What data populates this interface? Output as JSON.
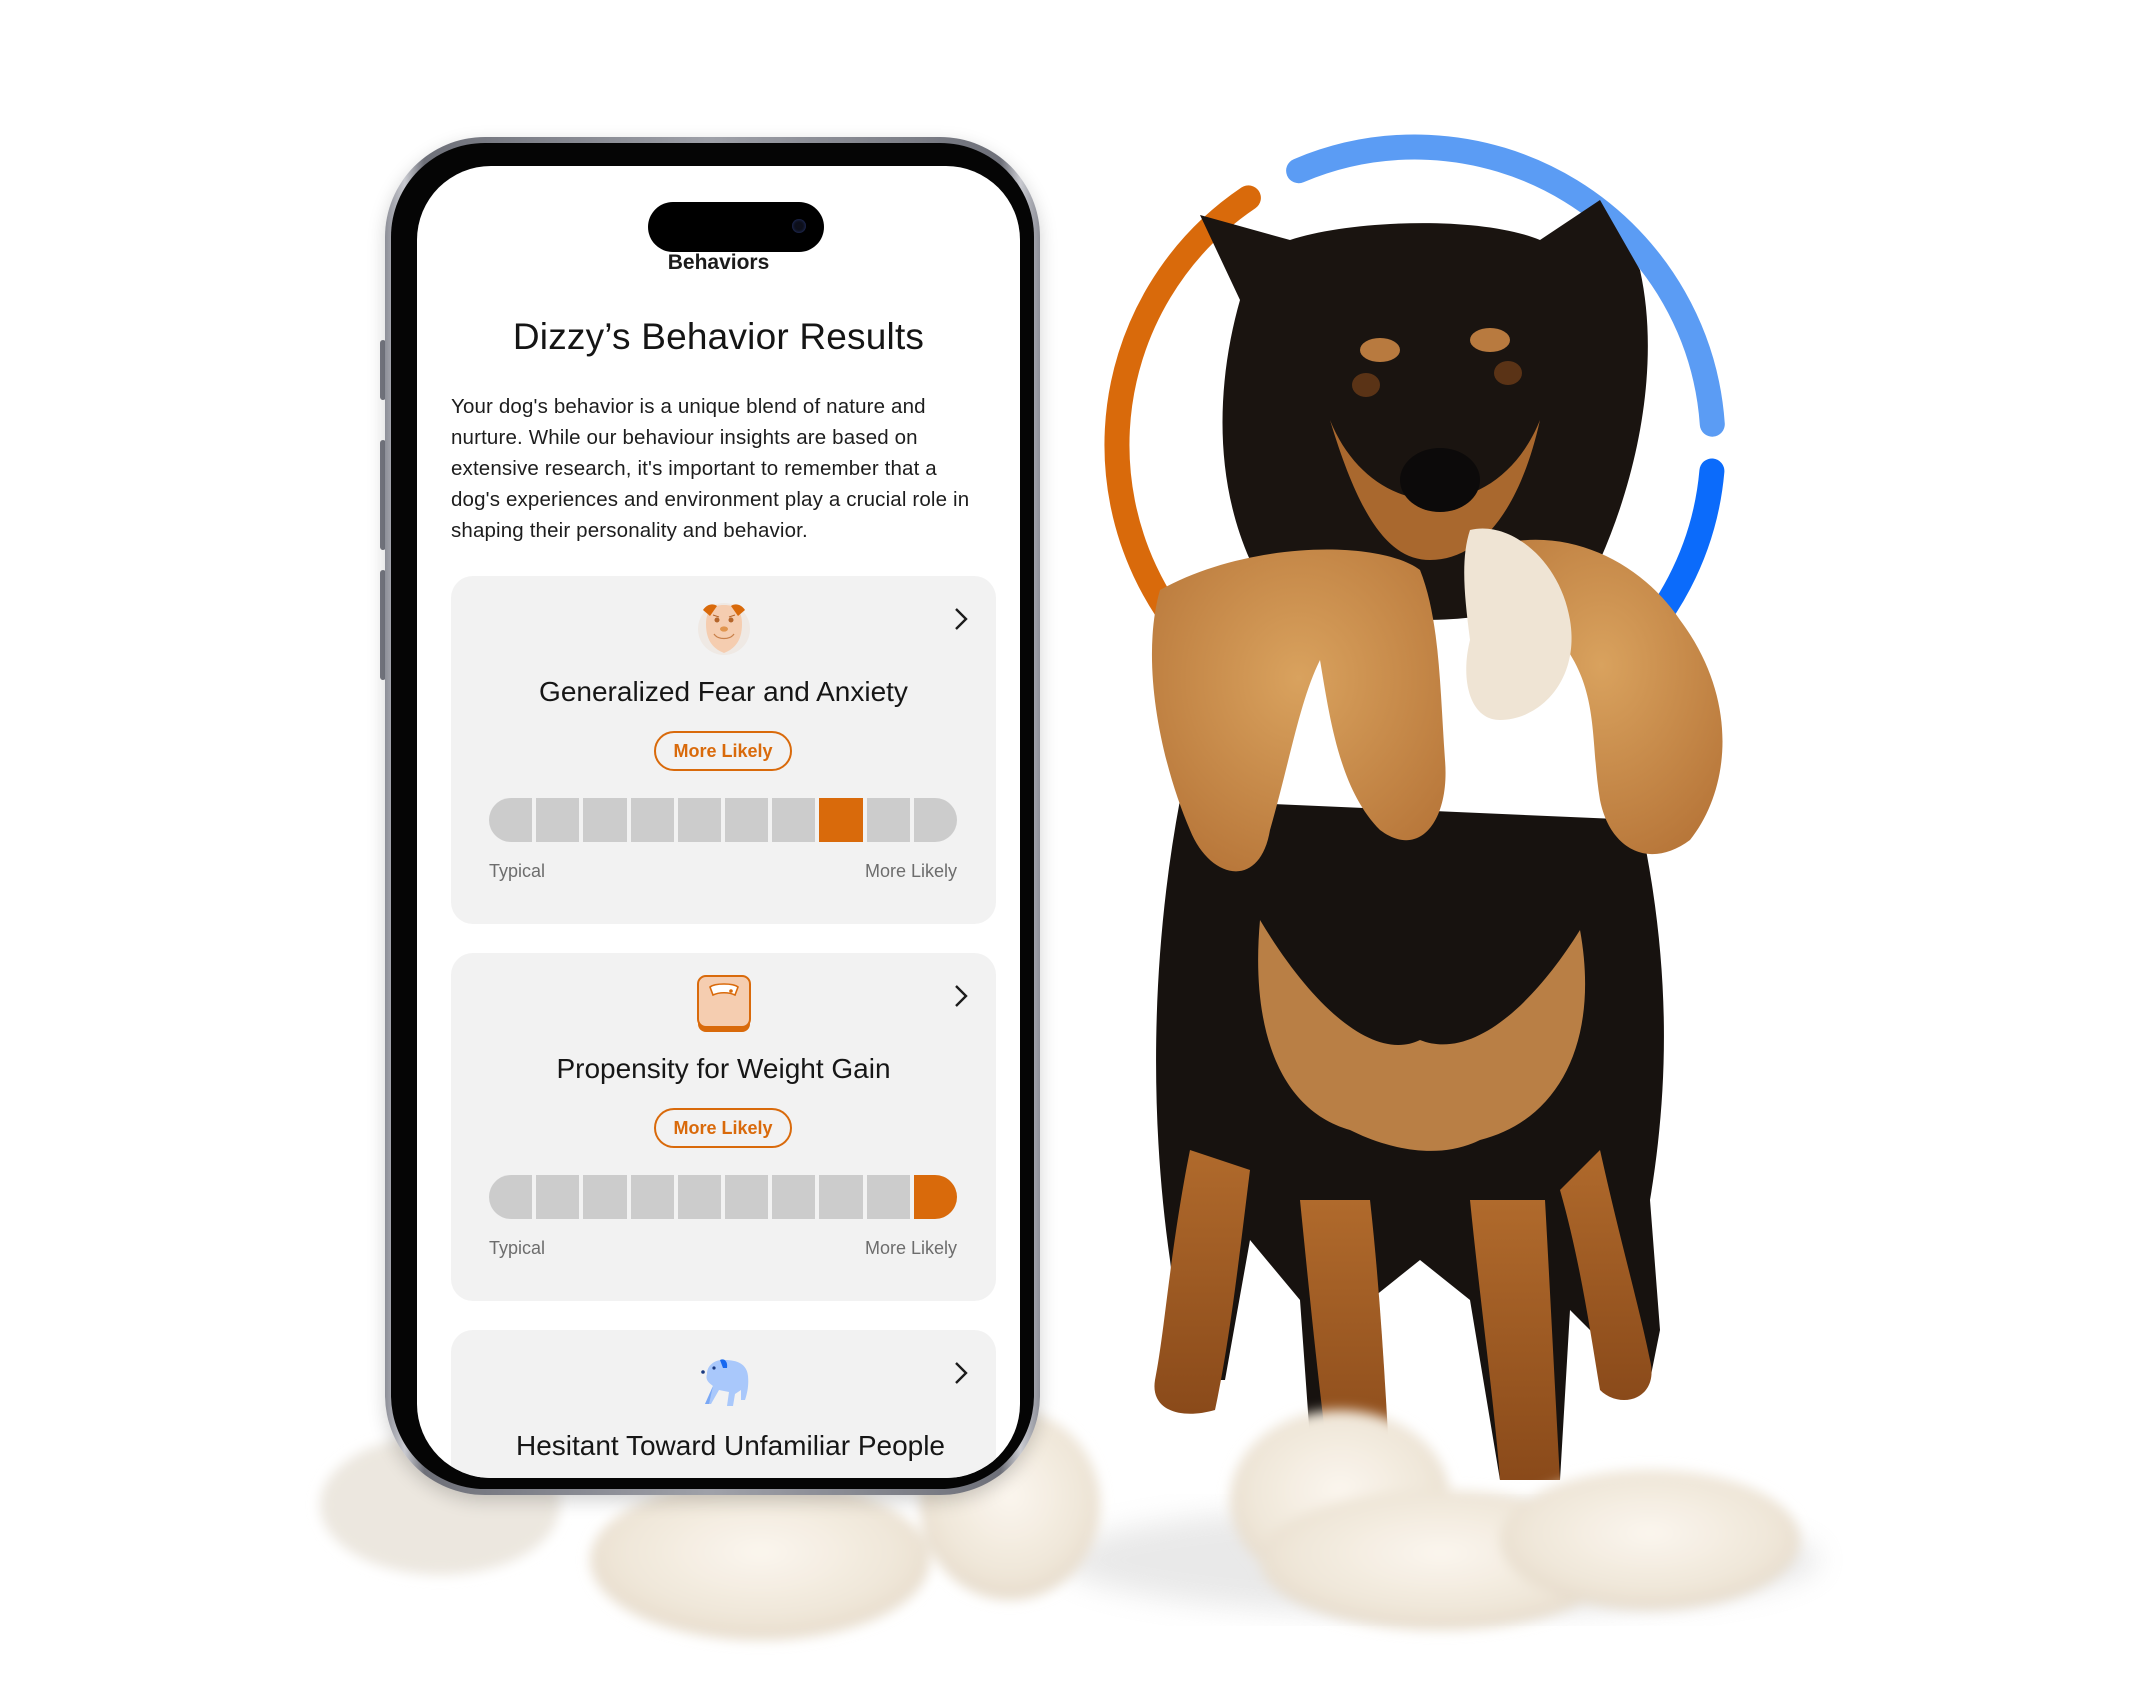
{
  "app": {
    "nav_title": "Behaviors",
    "page_title": "Dizzy’s Behavior Results",
    "intro": "Your dog's behavior is a unique blend of nature and nurture. While our behaviour insights are based on extensive research, it's important to remember that a dog's experiences and environment play a crucial role in shaping their personality and behavior."
  },
  "scale_labels": {
    "left": "Typical",
    "right": "More Likely"
  },
  "colors": {
    "accent_orange": "#d96a0b",
    "ring_light_blue": "#5b9cf4",
    "ring_bright_blue": "#0b6bfb",
    "ring_orange": "#d96a0b",
    "card_bg": "#f2f2f2",
    "segment_off": "#cccccc"
  },
  "cards": [
    {
      "title": "Generalized Fear and Anxiety",
      "icon": "anxious-dog-face-icon",
      "badge": "More Likely",
      "segments_total": 10,
      "active_segment": 8
    },
    {
      "title": "Propensity for Weight Gain",
      "icon": "weight-scale-icon",
      "badge": "More Likely",
      "segments_total": 10,
      "active_segment": 10
    },
    {
      "title": "Hesitant Toward Unfamiliar People",
      "icon": "hesitant-dog-icon"
    }
  ],
  "decor": {
    "photo_subject": "Tri-color dog holding plush toy, standing on cotton stuffing",
    "ring_segments": [
      "orange",
      "light-blue",
      "bright-blue"
    ]
  }
}
